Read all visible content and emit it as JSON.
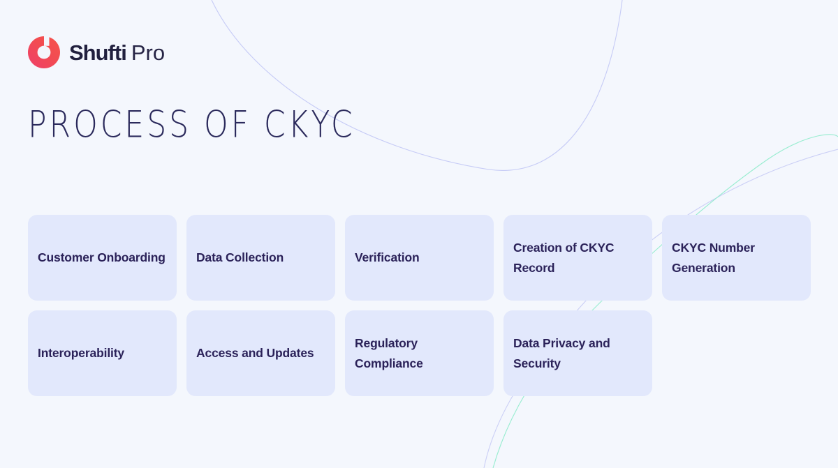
{
  "brand": {
    "logo_icon": "shufti-ring-icon",
    "name_bold": "Shufti",
    "name_light": "Pro",
    "accent_color": "#f2484f",
    "accent_color_2": "#ee3a63"
  },
  "header": {
    "title": "PROCESS OF CKYC",
    "title_color": "#2b2a5c"
  },
  "theme": {
    "background": "#f4f7fd",
    "card_background": "#e2e8fc",
    "card_text_color": "#2b2259",
    "curve_purple": "#c3c8f5",
    "curve_teal": "#92eccd"
  },
  "decor": {
    "curve_top_name": "top-arc-curve",
    "curve_teal_name": "teal-arc-curve",
    "curve_bottom_name": "bottom-arc-curve"
  },
  "steps": {
    "row_1": [
      {
        "label": "Customer Onboarding"
      },
      {
        "label": "Data Collection"
      },
      {
        "label": "Verification"
      },
      {
        "label": "Creation of CKYC Record"
      },
      {
        "label": "CKYC Number Generation"
      }
    ],
    "row_2": [
      {
        "label": "Interoperability"
      },
      {
        "label": "Access and Updates"
      },
      {
        "label": "Regulatory Compliance"
      },
      {
        "label": "Data Privacy and Security"
      }
    ]
  }
}
